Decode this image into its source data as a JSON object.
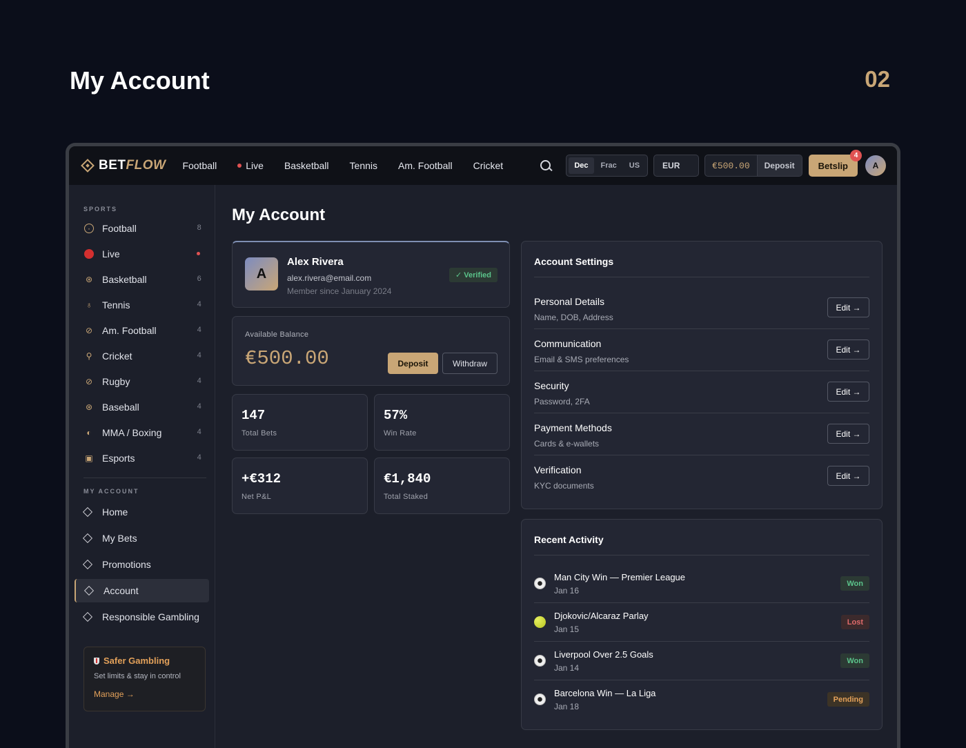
{
  "page": {
    "heading": "My Account",
    "number": "02"
  },
  "topbar": {
    "logo_bet": "BET",
    "logo_flow": "FLOW",
    "nav": [
      "Football",
      "Live",
      "Basketball",
      "Tennis",
      "Am. Football",
      "Cricket"
    ],
    "odds_formats": [
      "Dec",
      "Frac",
      "US"
    ],
    "odds_active": "Dec",
    "currency": "EUR",
    "balance": "€500.00",
    "deposit_label": "Deposit",
    "betslip_label": "Betslip",
    "betslip_count": "4",
    "avatar_initial": "A"
  },
  "sidebar": {
    "sports_heading": "SPORTS",
    "sports": [
      {
        "label": "Football",
        "count": "8",
        "icon": "football-icon"
      },
      {
        "label": "Live",
        "count": "",
        "icon": "live-icon"
      },
      {
        "label": "Basketball",
        "count": "6",
        "icon": "basketball-icon"
      },
      {
        "label": "Tennis",
        "count": "4",
        "icon": "tennis-icon"
      },
      {
        "label": "Am. Football",
        "count": "4",
        "icon": "am-football-icon"
      },
      {
        "label": "Cricket",
        "count": "4",
        "icon": "cricket-icon"
      },
      {
        "label": "Rugby",
        "count": "4",
        "icon": "rugby-icon"
      },
      {
        "label": "Baseball",
        "count": "4",
        "icon": "baseball-icon"
      },
      {
        "label": "MMA / Boxing",
        "count": "4",
        "icon": "boxing-icon"
      },
      {
        "label": "Esports",
        "count": "4",
        "icon": "gamepad-icon"
      }
    ],
    "account_heading": "MY ACCOUNT",
    "account_items": [
      "Home",
      "My Bets",
      "Promotions",
      "Account",
      "Responsible Gambling"
    ],
    "account_active": "Account",
    "safer": {
      "title": "Safer Gambling",
      "text": "Set limits & stay in control",
      "link": "Manage →"
    }
  },
  "main": {
    "title": "My Account",
    "profile": {
      "initial": "A",
      "name": "Alex Rivera",
      "email": "alex.rivera@email.com",
      "since": "Member since January 2024",
      "verified": "✓ Verified"
    },
    "balance": {
      "label": "Available Balance",
      "amount": "€500.00",
      "deposit": "Deposit",
      "withdraw": "Withdraw"
    },
    "stats": [
      {
        "value": "147",
        "label": "Total Bets"
      },
      {
        "value": "57%",
        "label": "Win Rate"
      },
      {
        "value": "+€312",
        "label": "Net P&L"
      },
      {
        "value": "€1,840",
        "label": "Total Staked"
      }
    ],
    "settings": {
      "title": "Account Settings",
      "edit_label": "Edit →",
      "rows": [
        {
          "name": "Personal Details",
          "sub": "Name, DOB, Address"
        },
        {
          "name": "Communication",
          "sub": "Email & SMS preferences"
        },
        {
          "name": "Security",
          "sub": "Password, 2FA"
        },
        {
          "name": "Payment Methods",
          "sub": "Cards & e-wallets"
        },
        {
          "name": "Verification",
          "sub": "KYC documents"
        }
      ]
    },
    "activity": {
      "title": "Recent Activity",
      "rows": [
        {
          "title": "Man City Win — Premier League",
          "date": "Jan 16",
          "status": "Won",
          "icon": "soccer-ball-icon"
        },
        {
          "title": "Djokovic/Alcaraz Parlay",
          "date": "Jan 15",
          "status": "Lost",
          "icon": "tennis-ball-icon"
        },
        {
          "title": "Liverpool Over 2.5 Goals",
          "date": "Jan 14",
          "status": "Won",
          "icon": "soccer-ball-icon"
        },
        {
          "title": "Barcelona Win — La Liga",
          "date": "Jan 18",
          "status": "Pending",
          "icon": "soccer-ball-icon"
        }
      ]
    }
  },
  "colors": {
    "accent": "#c9a676",
    "won": "#5bc48b",
    "lost": "#e06b6b",
    "pending": "#e3a15a",
    "live": "#e05252"
  }
}
